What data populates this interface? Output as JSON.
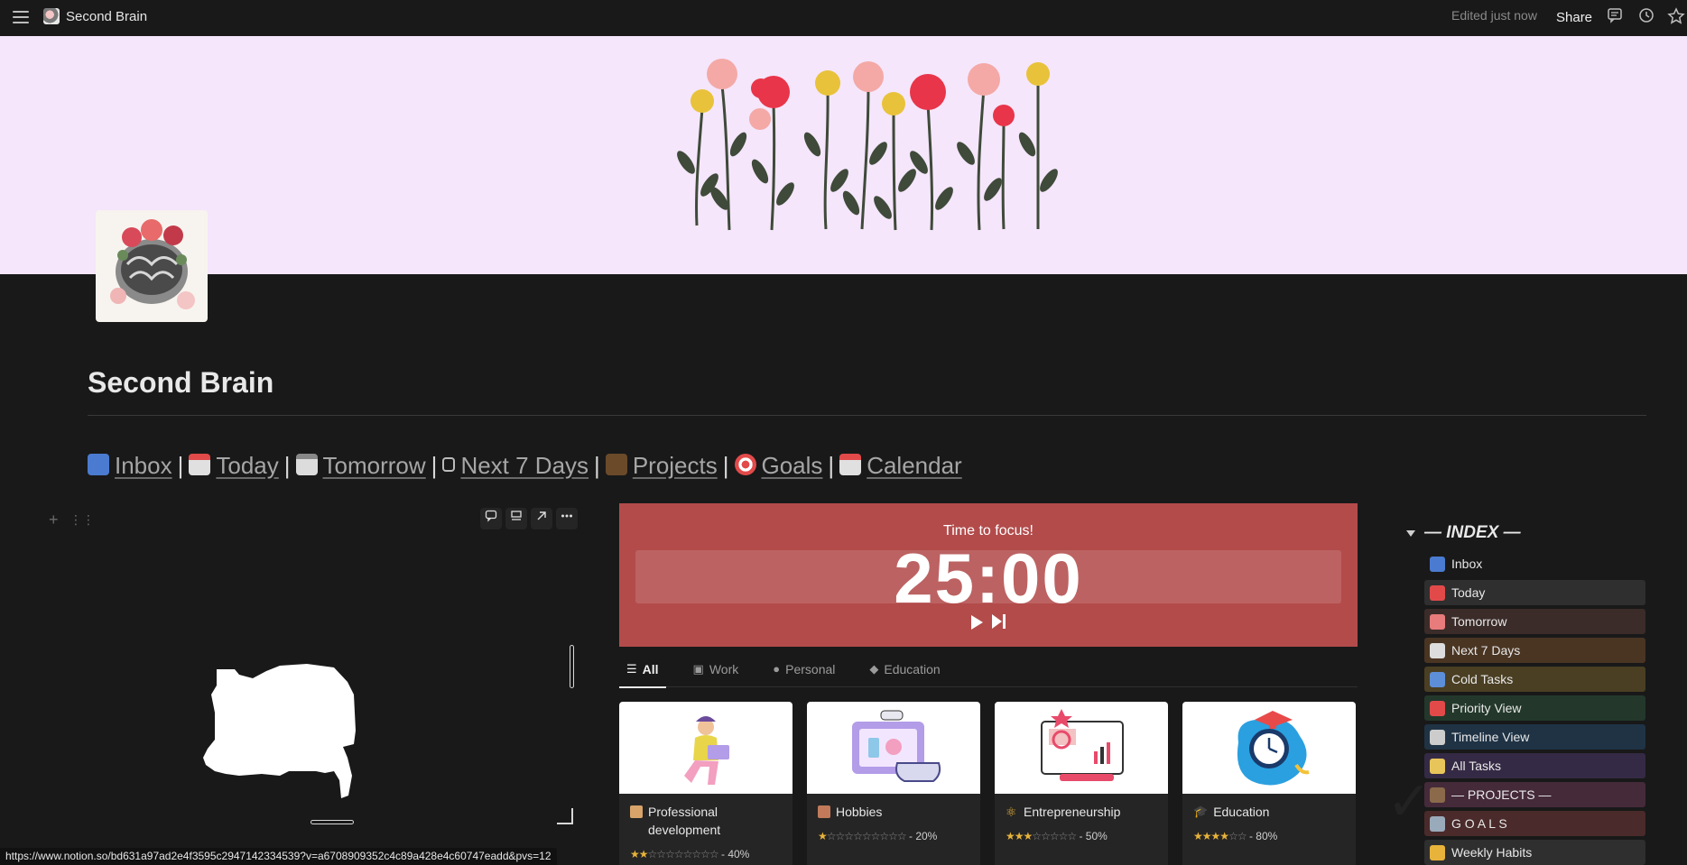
{
  "topbar": {
    "breadcrumb": "Second Brain",
    "edited": "Edited just now",
    "share": "Share"
  },
  "page": {
    "title": "Second Brain"
  },
  "nav": [
    {
      "label": "Inbox"
    },
    {
      "label": "Today"
    },
    {
      "label": "Tomorrow"
    },
    {
      "label": "Next 7 Days"
    },
    {
      "label": "Projects"
    },
    {
      "label": "Goals"
    },
    {
      "label": "Calendar"
    }
  ],
  "nav_separator": "|",
  "timer": {
    "label": "Time to focus!",
    "value": "25:00",
    "color": "#b34b4b"
  },
  "tabs": [
    {
      "label": "All",
      "icon": "checklist-icon"
    },
    {
      "label": "Work",
      "icon": "briefcase-icon"
    },
    {
      "label": "Personal",
      "icon": "person-icon"
    },
    {
      "label": "Education",
      "icon": "graduation-cap-icon"
    }
  ],
  "cards": [
    {
      "name": "Professional development",
      "rating_text": "- 40%",
      "stars_on": 2,
      "stars_total": 10
    },
    {
      "name": "Hobbies",
      "rating_text": "- 20%",
      "stars_on": 1,
      "stars_total": 10
    },
    {
      "name": "Entrepreneurship",
      "rating_text": "- 50%",
      "stars_on": 3,
      "stars_total": 8
    },
    {
      "name": "Education",
      "rating_text": "- 80%",
      "stars_on": 4,
      "stars_total": 6
    }
  ],
  "index": {
    "title": "— INDEX —",
    "items": [
      {
        "label": "Inbox",
        "bg": "transparent",
        "icon_color": "#4a7bd0"
      },
      {
        "label": "Today",
        "bg": "#2f2f2f",
        "icon_color": "#e24a4a"
      },
      {
        "label": "Tomorrow",
        "bg": "#3b2c29",
        "icon_color": "#e87b7b"
      },
      {
        "label": "Next 7 Days",
        "bg": "#4a3523",
        "icon_color": "#ddd"
      },
      {
        "label": "Cold Tasks",
        "bg": "#4a3f23",
        "icon_color": "#5d8fd8"
      },
      {
        "label": "Priority View",
        "bg": "#23382b",
        "icon_color": "#e24a4a"
      },
      {
        "label": "Timeline View",
        "bg": "#1f3345",
        "icon_color": "#ccc"
      },
      {
        "label": "All Tasks",
        "bg": "#352a45",
        "icon_color": "#e8c55a"
      },
      {
        "label": "— PROJECTS —",
        "bg": "#452a3a",
        "icon_color": "#8a6a4a"
      },
      {
        "label": "G O A L S",
        "bg": "#4a2a2a",
        "icon_color": "#9ab"
      },
      {
        "label": "Weekly Habits",
        "bg": "#2f2f2f",
        "icon_color": "#e8b33a"
      }
    ]
  },
  "status_url": "https://www.notion.so/bd631a97ad2e4f3595c2947142334539?v=a6708909352c4c89a428e4c60747eadd&pvs=12"
}
